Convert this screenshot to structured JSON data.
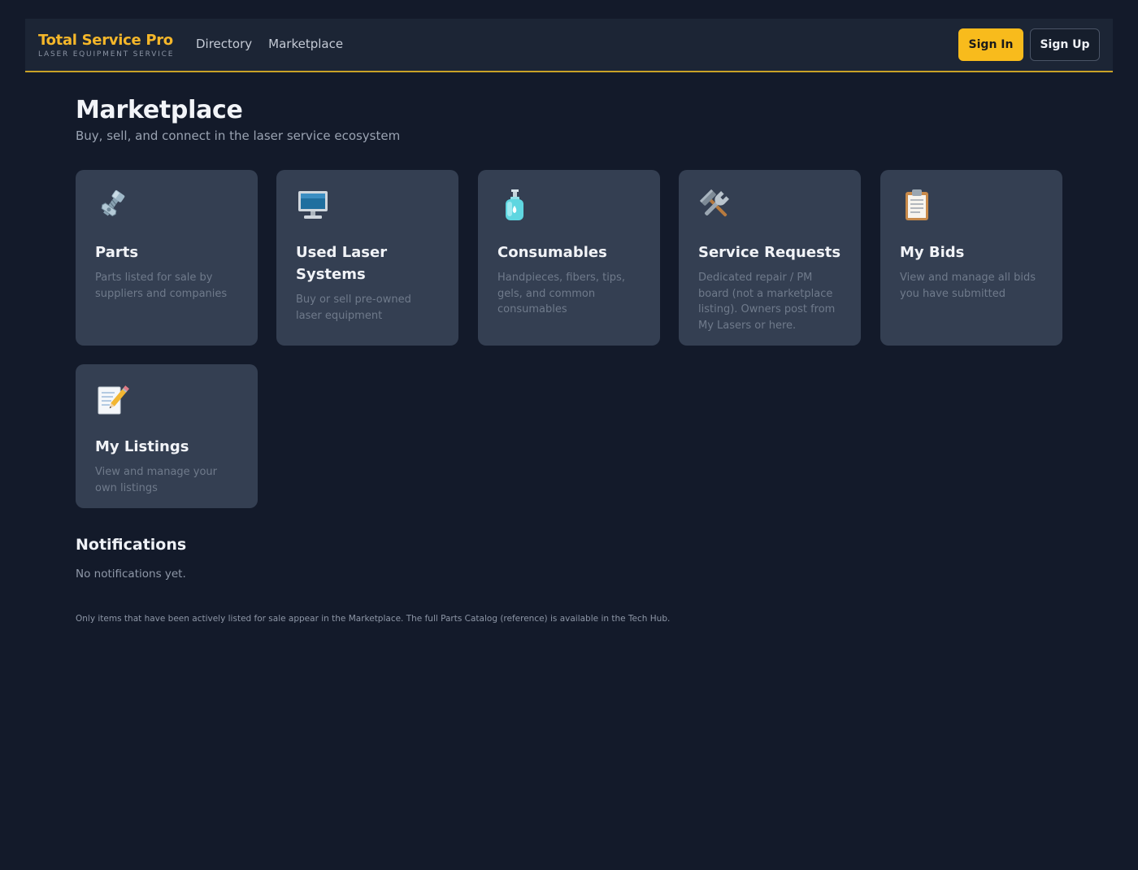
{
  "nav": {
    "brand_title": "Total Service Pro",
    "brand_subtitle": "LASER EQUIPMENT SERVICE",
    "links": [
      "Directory",
      "Marketplace"
    ],
    "sign_in": "Sign In",
    "sign_up": "Sign Up"
  },
  "page": {
    "title": "Marketplace",
    "subtitle": "Buy, sell, and connect in the laser service ecosystem"
  },
  "cards": [
    {
      "icon": "nut-and-bolt-icon",
      "title": "Parts",
      "description": "Parts listed for sale by suppliers and companies"
    },
    {
      "icon": "desktop-computer-icon",
      "title": "Used Laser Systems",
      "description": "Buy or sell pre-owned laser equipment"
    },
    {
      "icon": "lotion-bottle-icon",
      "title": "Consumables",
      "description": "Handpieces, fibers, tips, gels, and common consumables"
    },
    {
      "icon": "hammer-and-wrench-icon",
      "title": "Service Requests",
      "description": "Dedicated repair / PM board (not a marketplace listing). Owners post from My Lasers or here."
    },
    {
      "icon": "clipboard-icon",
      "title": "My Bids",
      "description": "View and manage all bids you have submitted"
    },
    {
      "icon": "memo-icon",
      "title": "My Listings",
      "description": "View and manage your own listings"
    }
  ],
  "notifications": {
    "title": "Notifications",
    "empty_text": "No notifications yet."
  },
  "footnote": "Only items that have been actively listed for sale appear in the Marketplace. The full Parts Catalog (reference) is available in the Tech Hub.",
  "colors": {
    "background": "#131a2a",
    "navbar": "#1c2535",
    "accent": "#f8bb1c",
    "card": "#343f52"
  }
}
